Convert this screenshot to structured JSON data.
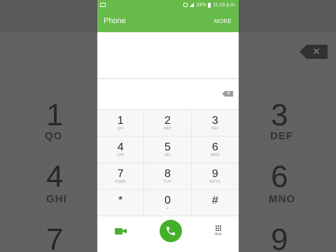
{
  "status_bar": {
    "battery": "33%",
    "time": "11:16 p.m."
  },
  "app_bar": {
    "title": "Phone",
    "more_label": "MORE"
  },
  "keypad": [
    {
      "digit": "1",
      "letters": "QO"
    },
    {
      "digit": "2",
      "letters": "ABC"
    },
    {
      "digit": "3",
      "letters": "DEF"
    },
    {
      "digit": "4",
      "letters": "GHI"
    },
    {
      "digit": "5",
      "letters": "JKL"
    },
    {
      "digit": "6",
      "letters": "MNO"
    },
    {
      "digit": "7",
      "letters": "PQRS"
    },
    {
      "digit": "8",
      "letters": "TUV"
    },
    {
      "digit": "9",
      "letters": "WXYZ"
    },
    {
      "digit": "*",
      "letters": ""
    },
    {
      "digit": "0",
      "letters": "+"
    },
    {
      "digit": "#",
      "letters": ""
    }
  ],
  "action_bar": {
    "hide_label": "Hide"
  },
  "background": {
    "left": [
      {
        "digit": "1",
        "letters": "QO"
      },
      {
        "digit": "4",
        "letters": "GHI"
      },
      {
        "digit": "7",
        "letters": ""
      }
    ],
    "right": [
      {
        "digit": "3",
        "letters": "DEF"
      },
      {
        "digit": "6",
        "letters": "MNO"
      },
      {
        "digit": "9",
        "letters": ""
      }
    ]
  },
  "colors": {
    "accent": "#66bb4a",
    "call_button": "#43b02a"
  },
  "icons": {
    "delete": "backspace-icon",
    "video_call": "video-call-icon",
    "call": "phone-call-icon",
    "hide": "dialpad-icon"
  }
}
